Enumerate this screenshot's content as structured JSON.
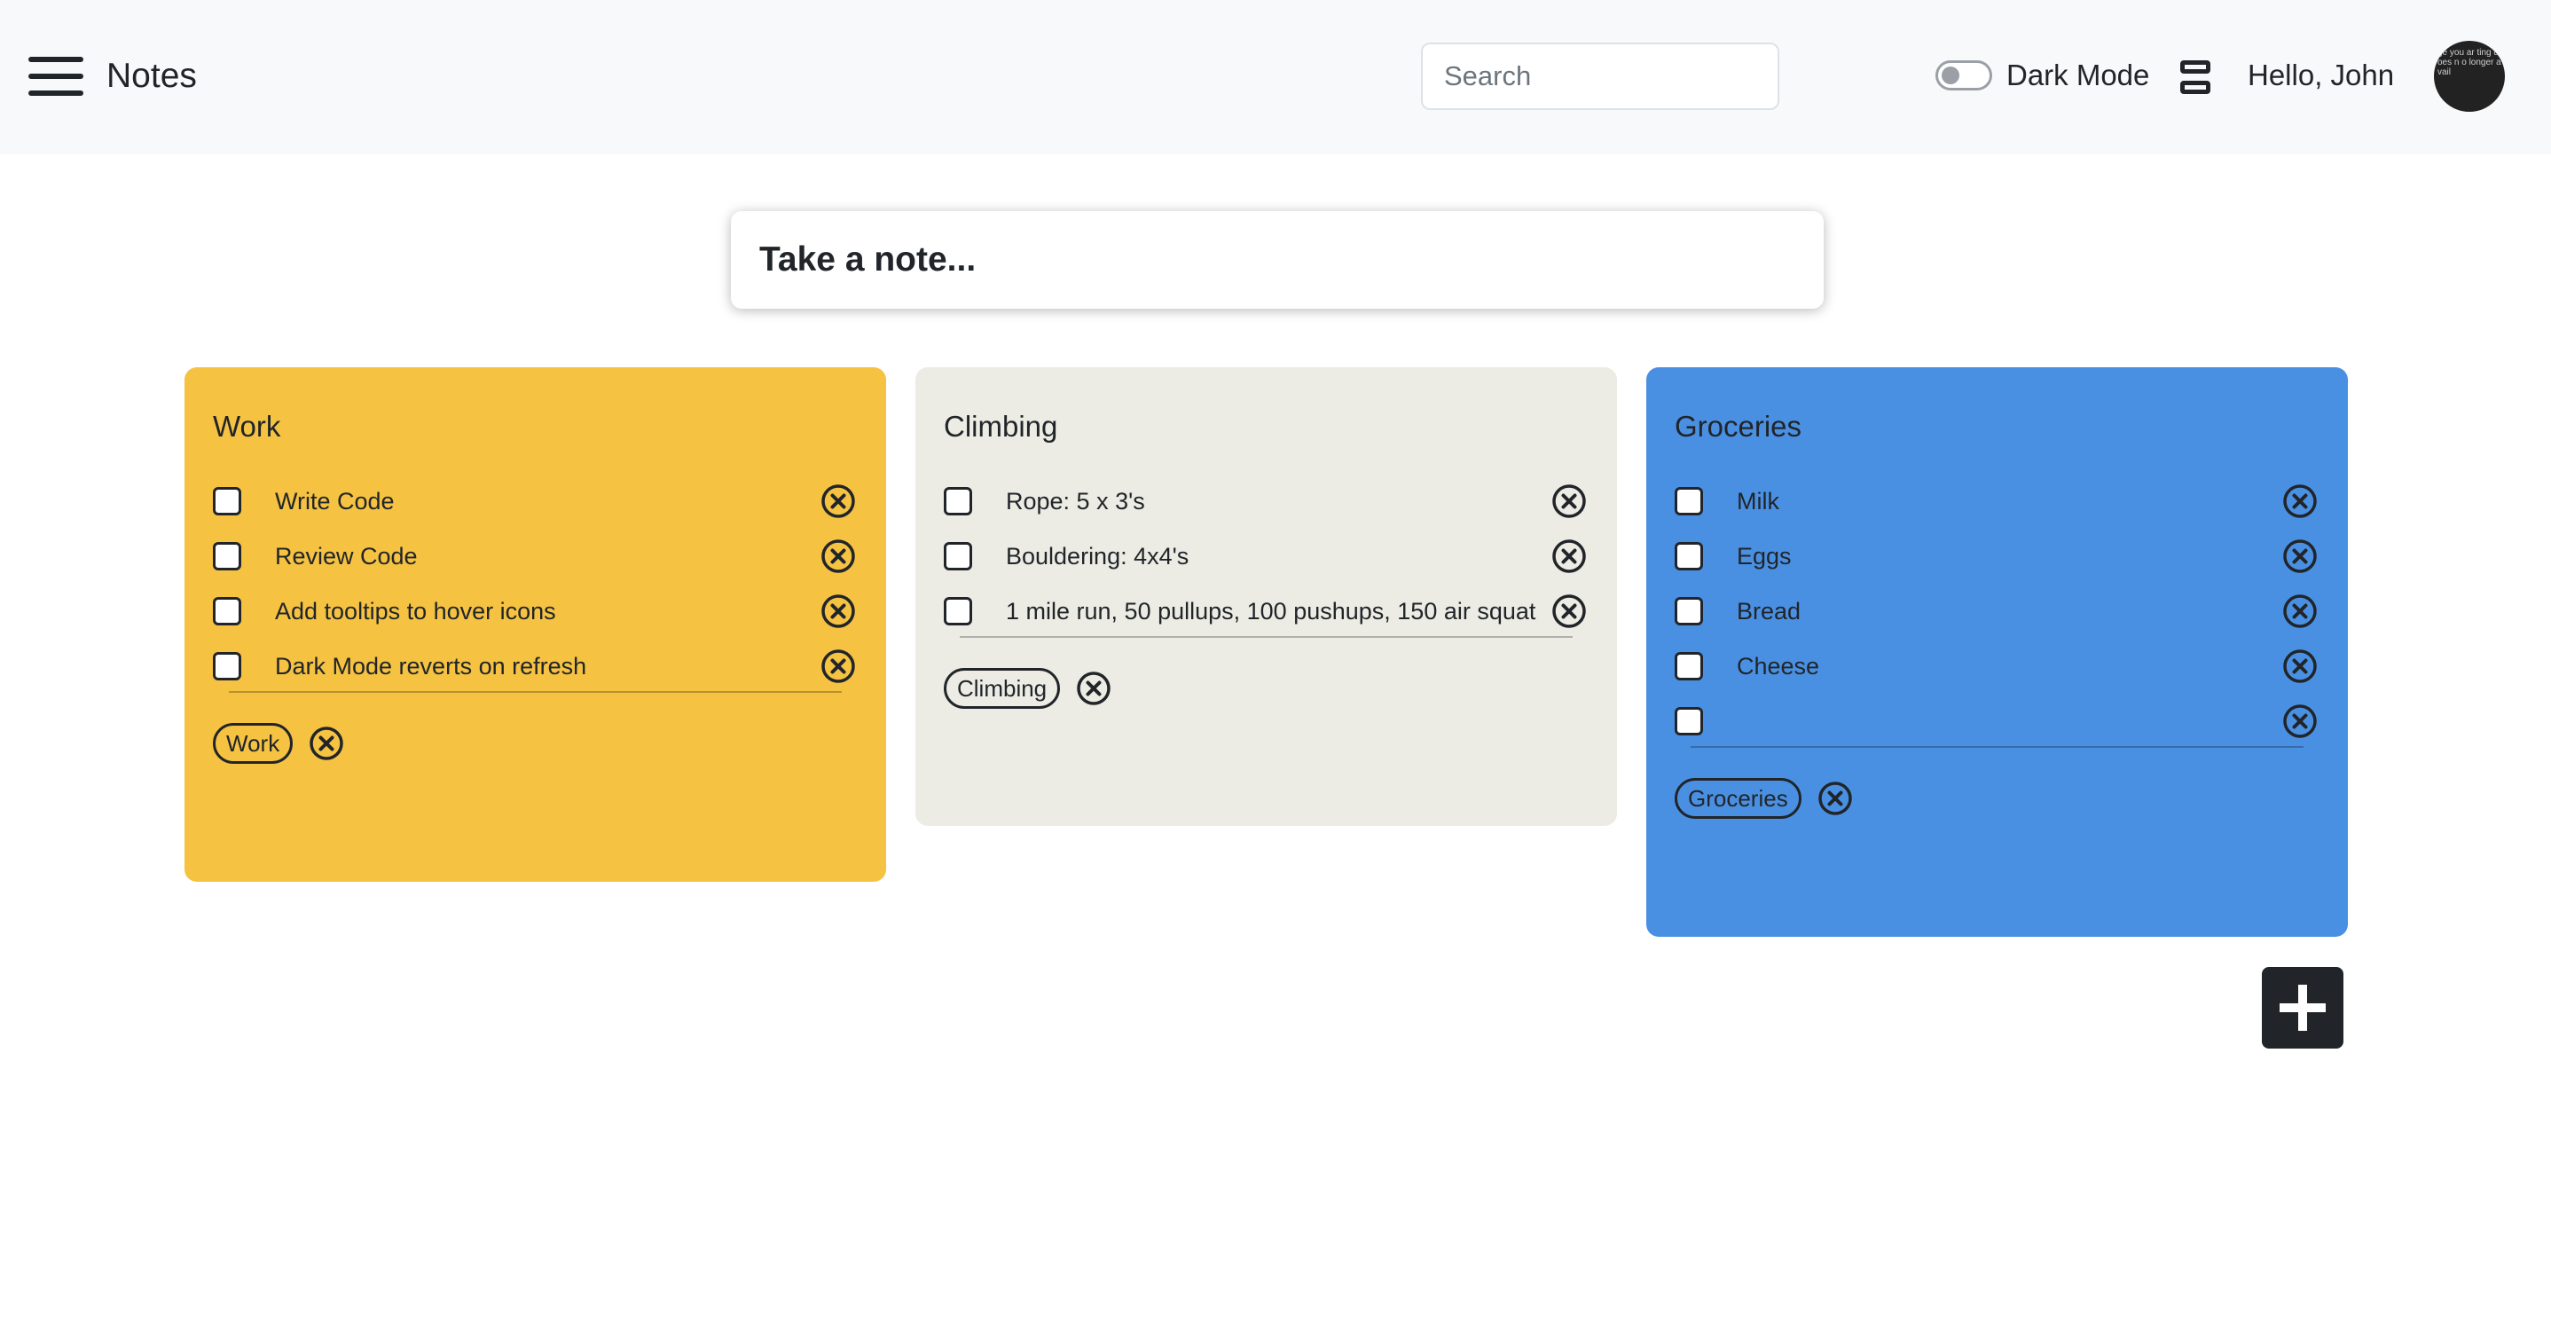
{
  "header": {
    "app_title": "Notes",
    "search_placeholder": "Search",
    "dark_mode_label": "Dark Mode",
    "greeting": "Hello, John",
    "avatar_alt_text": "ge you ar ting does n o longer avail"
  },
  "composer": {
    "placeholder": "Take a note..."
  },
  "colors": {
    "work": "#f5c242",
    "climbing": "#ecece4",
    "groceries": "#4a90e2"
  },
  "notes": [
    {
      "title": "Work",
      "color": "#f5c242",
      "items": [
        "Write Code",
        "Review Code",
        "Add tooltips to hover icons",
        "Dark Mode reverts on refresh"
      ],
      "tag": "Work"
    },
    {
      "title": "Climbing",
      "color": "#ecece4",
      "items": [
        "Rope: 5 x 3's",
        "Bouldering: 4x4's",
        "1 mile run, 50 pullups, 100 pushups, 150 air squat"
      ],
      "tag": "Climbing"
    },
    {
      "title": "Groceries",
      "color": "#4a90e2",
      "items": [
        "Milk",
        "Eggs",
        "Bread",
        "Cheese",
        ""
      ],
      "tag": "Groceries"
    }
  ],
  "icons": {
    "menu": "hamburger-icon",
    "layout": "layout-rows-icon",
    "delete": "close-circle-icon",
    "add": "plus-icon"
  }
}
